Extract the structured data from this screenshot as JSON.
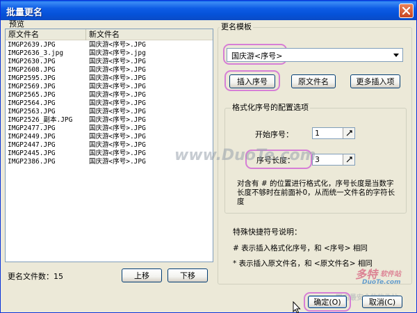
{
  "window": {
    "title": "批量更名"
  },
  "preview": {
    "group_label": "预览",
    "columns": [
      "原文件名",
      "新文件名"
    ],
    "rows": [
      [
        "IMGP2639.JPG",
        "国庆游<序号>.JPG"
      ],
      [
        "IMGP2636_3.jpg",
        "国庆游<序号>.jpg"
      ],
      [
        "IMGP2630.JPG",
        "国庆游<序号>.JPG"
      ],
      [
        "IMGP2608.JPG",
        "国庆游<序号>.JPG"
      ],
      [
        "IMGP2595.JPG",
        "国庆游<序号>.JPG"
      ],
      [
        "IMGP2569.JPG",
        "国庆游<序号>.JPG"
      ],
      [
        "IMGP2565.JPG",
        "国庆游<序号>.JPG"
      ],
      [
        "IMGP2564.JPG",
        "国庆游<序号>.JPG"
      ],
      [
        "IMGP2563.JPG",
        "国庆游<序号>.JPG"
      ],
      [
        "IMGP2526_副本.JPG",
        "国庆游<序号>.JPG"
      ],
      [
        "IMGP2477.JPG",
        "国庆游<序号>.JPG"
      ],
      [
        "IMGP2449.JPG",
        "国庆游<序号>.JPG"
      ],
      [
        "IMGP2447.JPG",
        "国庆游<序号>.JPG"
      ],
      [
        "IMGP2445.JPG",
        "国庆游<序号>.JPG"
      ],
      [
        "IMGP2386.JPG",
        "国庆游<序号>.JPG"
      ]
    ],
    "count_label": "更名文件数：15",
    "move_up": "上移",
    "move_down": "下移"
  },
  "template": {
    "group_label": "更名模板",
    "value": "国庆游<序号>",
    "insert_seq": "插入序号",
    "orig_name": "原文件名",
    "more_insert": "更多插入项"
  },
  "format": {
    "group_label": "格式化序号的配置选项",
    "start_label": "开始序号：",
    "start_value": "1",
    "length_label": "序号长度：",
    "length_value": "3",
    "description": "对含有 # 的位置进行格式化，序号长度是当数字长度不够时在前面补0，从而统一文件名的字符长度"
  },
  "special": {
    "title": "特殊快捷符号说明：",
    "line1": "# 表示插入格式化序号，和 <序号> 相同",
    "line2": "* 表示插入原文件名，和 <原文件名> 相同"
  },
  "footer": {
    "ok": "确定(O)",
    "cancel": "取消(C)"
  },
  "watermarks": {
    "center": "www.DuoTe.com",
    "logo": "多特",
    "logo_sub": "软件站",
    "logo_url": "DuoTe.com",
    "slogan": "国内最安全的软件站"
  },
  "colors": {
    "titlebar": "#0552d9",
    "highlight": "#d67ed6",
    "list_border": "#7f9db9"
  }
}
